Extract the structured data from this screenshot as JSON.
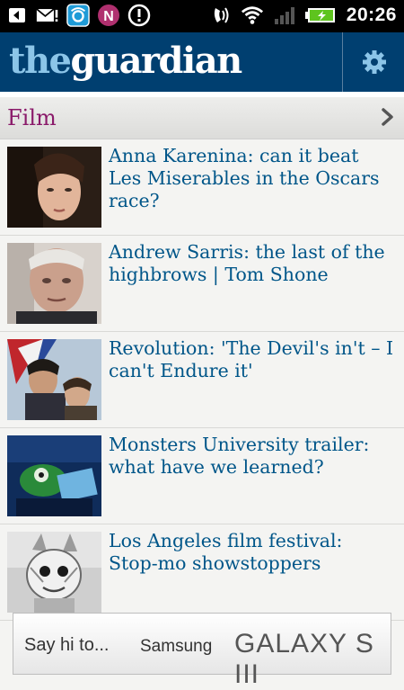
{
  "status_bar": {
    "time": "20:26",
    "notification_icons": [
      "usb-debug-icon",
      "mail-icon",
      "app-icon",
      "notifications-icon",
      "alert-icon"
    ],
    "system_icons": [
      "vibrate-icon",
      "wifi-icon",
      "signal-icon",
      "battery-icon"
    ]
  },
  "header": {
    "logo_the": "the",
    "logo_guardian": "guardian",
    "settings_icon": "gear-icon"
  },
  "section": {
    "title": "Film"
  },
  "articles": [
    {
      "headline": "Anna Karenina: can it beat Les Miserables in the Oscars race?"
    },
    {
      "headline": "Andrew Sarris: the last of the highbrows | Tom Shone"
    },
    {
      "headline": "Revolution: 'The Devil's in't – I can't Endure it'"
    },
    {
      "headline": "Monsters University trailer: what have we learned?"
    },
    {
      "headline": "Los Angeles film festival: Stop-mo showstoppers"
    }
  ],
  "ad": {
    "say": "Say hi to...",
    "brand": "Samsung",
    "product": "GALAXY S III"
  },
  "colors": {
    "header_bg": "#003f70",
    "logo_the": "#8cc5e8",
    "section_title": "#8a1a6a",
    "headline": "#005689"
  }
}
